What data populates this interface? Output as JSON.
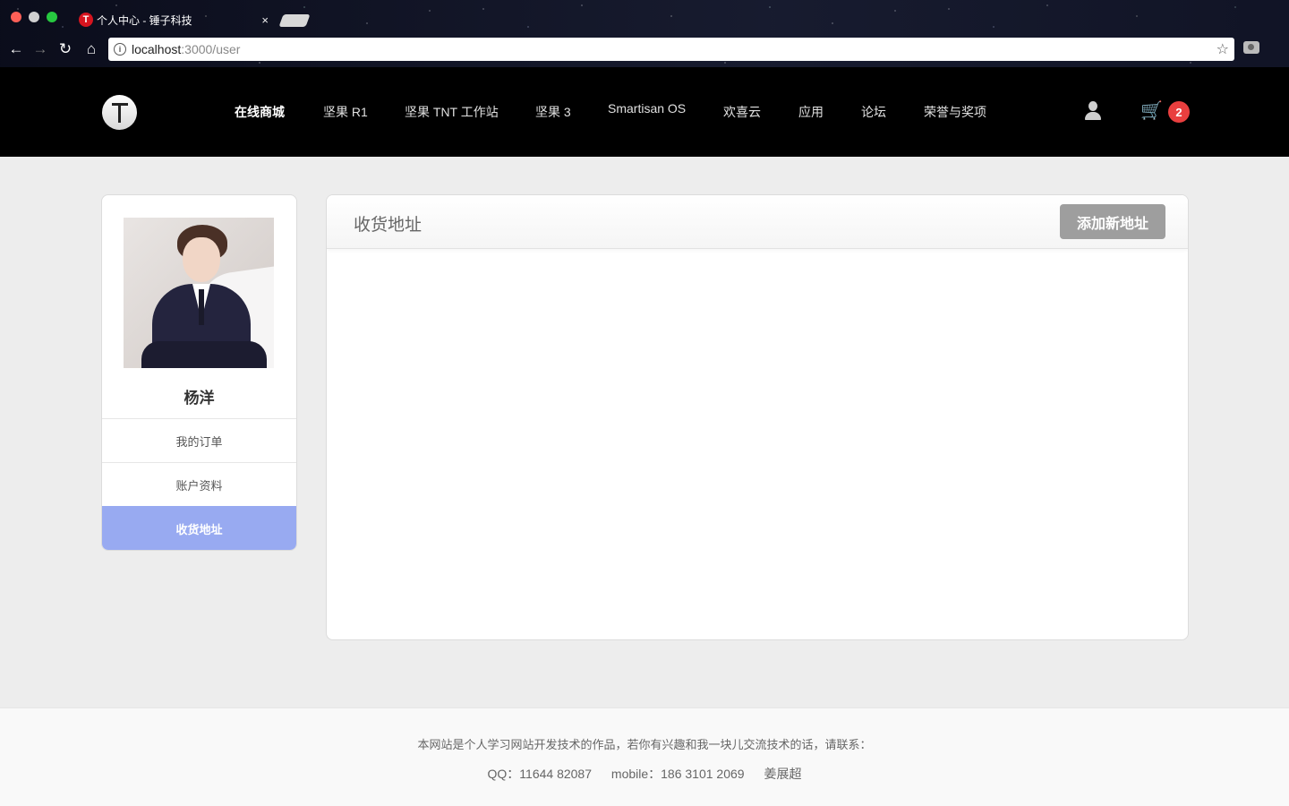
{
  "browser": {
    "tab_title": "个人中心 - 锤子科技",
    "tab_favicon_letter": "T",
    "tab_close": "×",
    "url_host": "localhost",
    "url_path": ":3000/user"
  },
  "header": {
    "nav": [
      {
        "label": "在线商城",
        "active": true
      },
      {
        "label": "坚果 R1"
      },
      {
        "label": "坚果 TNT 工作站"
      },
      {
        "label": "坚果 3"
      },
      {
        "label": "Smartisan OS"
      },
      {
        "label": "欢喜云"
      },
      {
        "label": "应用"
      },
      {
        "label": "论坛"
      },
      {
        "label": "荣誉与奖项"
      }
    ],
    "cart_count": "2"
  },
  "sidebar": {
    "username": "杨洋",
    "menu": [
      {
        "label": "我的订单"
      },
      {
        "label": "账户资料"
      },
      {
        "label": "收货地址",
        "active": true
      }
    ]
  },
  "main": {
    "title": "收货地址",
    "add_button": "添加新地址"
  },
  "footer": {
    "line1": "本网站是个人学习网站开发技术的作品，若你有兴趣和我一块儿交流技术的话，请联系：",
    "qq": "QQ：11644 82087",
    "mobile": "mobile：186 3101 2069",
    "name": "姜展超"
  },
  "colors": {
    "header_bg": "#000000",
    "active_menu": "#98aaf1",
    "badge": "#e93f3f",
    "button": "#9e9e9e"
  }
}
